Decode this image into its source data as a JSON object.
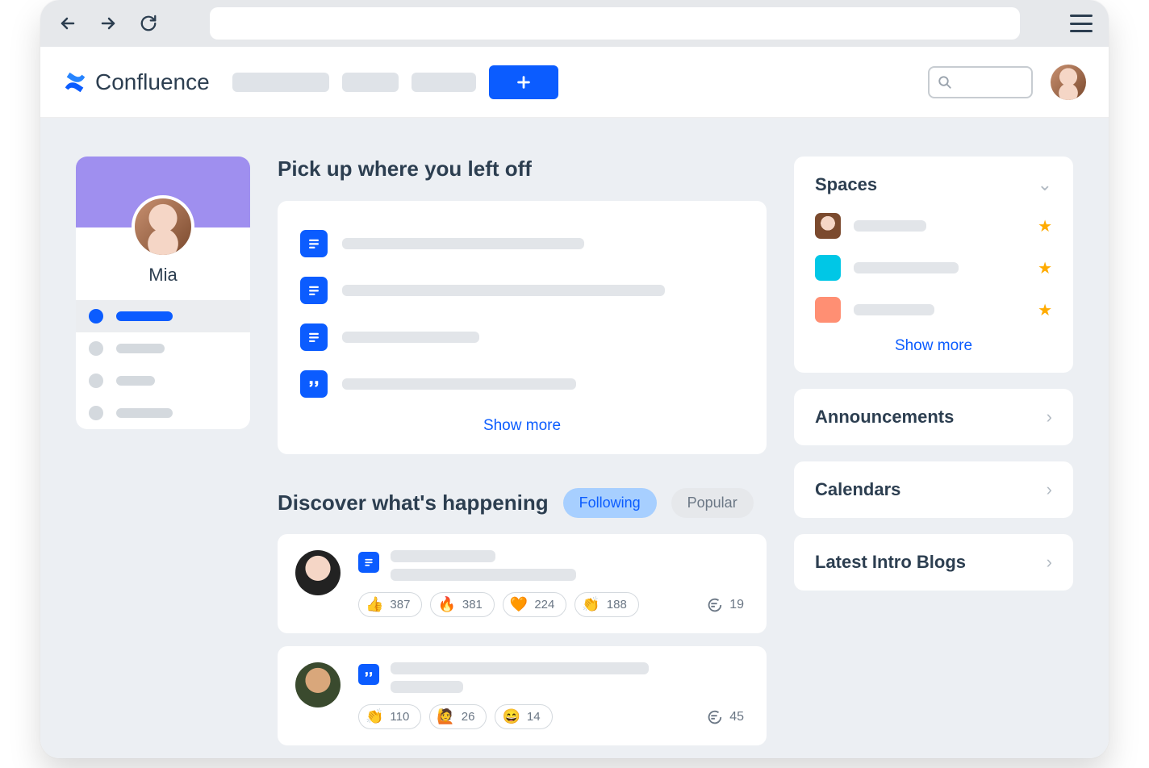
{
  "app": {
    "name": "Confluence"
  },
  "profile": {
    "name": "Mia"
  },
  "sections": {
    "pickup_title": "Pick up where you left off",
    "discover_title": "Discover what's happening",
    "show_more": "Show more"
  },
  "recent": [
    {
      "type": "page"
    },
    {
      "type": "page"
    },
    {
      "type": "page"
    },
    {
      "type": "quote"
    }
  ],
  "tabs": {
    "following": "Following",
    "popular": "Popular"
  },
  "feed": [
    {
      "type": "page",
      "reactions": [
        {
          "emoji": "👍",
          "count": 387
        },
        {
          "emoji": "🔥",
          "count": 381
        },
        {
          "emoji": "🧡",
          "count": 224
        },
        {
          "emoji": "👏",
          "count": 188
        }
      ],
      "comments": 19
    },
    {
      "type": "quote",
      "reactions": [
        {
          "emoji": "👏",
          "count": 110
        },
        {
          "emoji": "🙋",
          "count": 26
        },
        {
          "emoji": "😄",
          "count": 14
        }
      ],
      "comments": 45
    }
  ],
  "sidebar": {
    "spaces_title": "Spaces",
    "spaces": [
      {
        "color": "avatar"
      },
      {
        "color": "#00c7e6"
      },
      {
        "color": "#ff8f73"
      }
    ],
    "announcements": "Announcements",
    "calendars": "Calendars",
    "latest_blogs": "Latest Intro Blogs"
  }
}
